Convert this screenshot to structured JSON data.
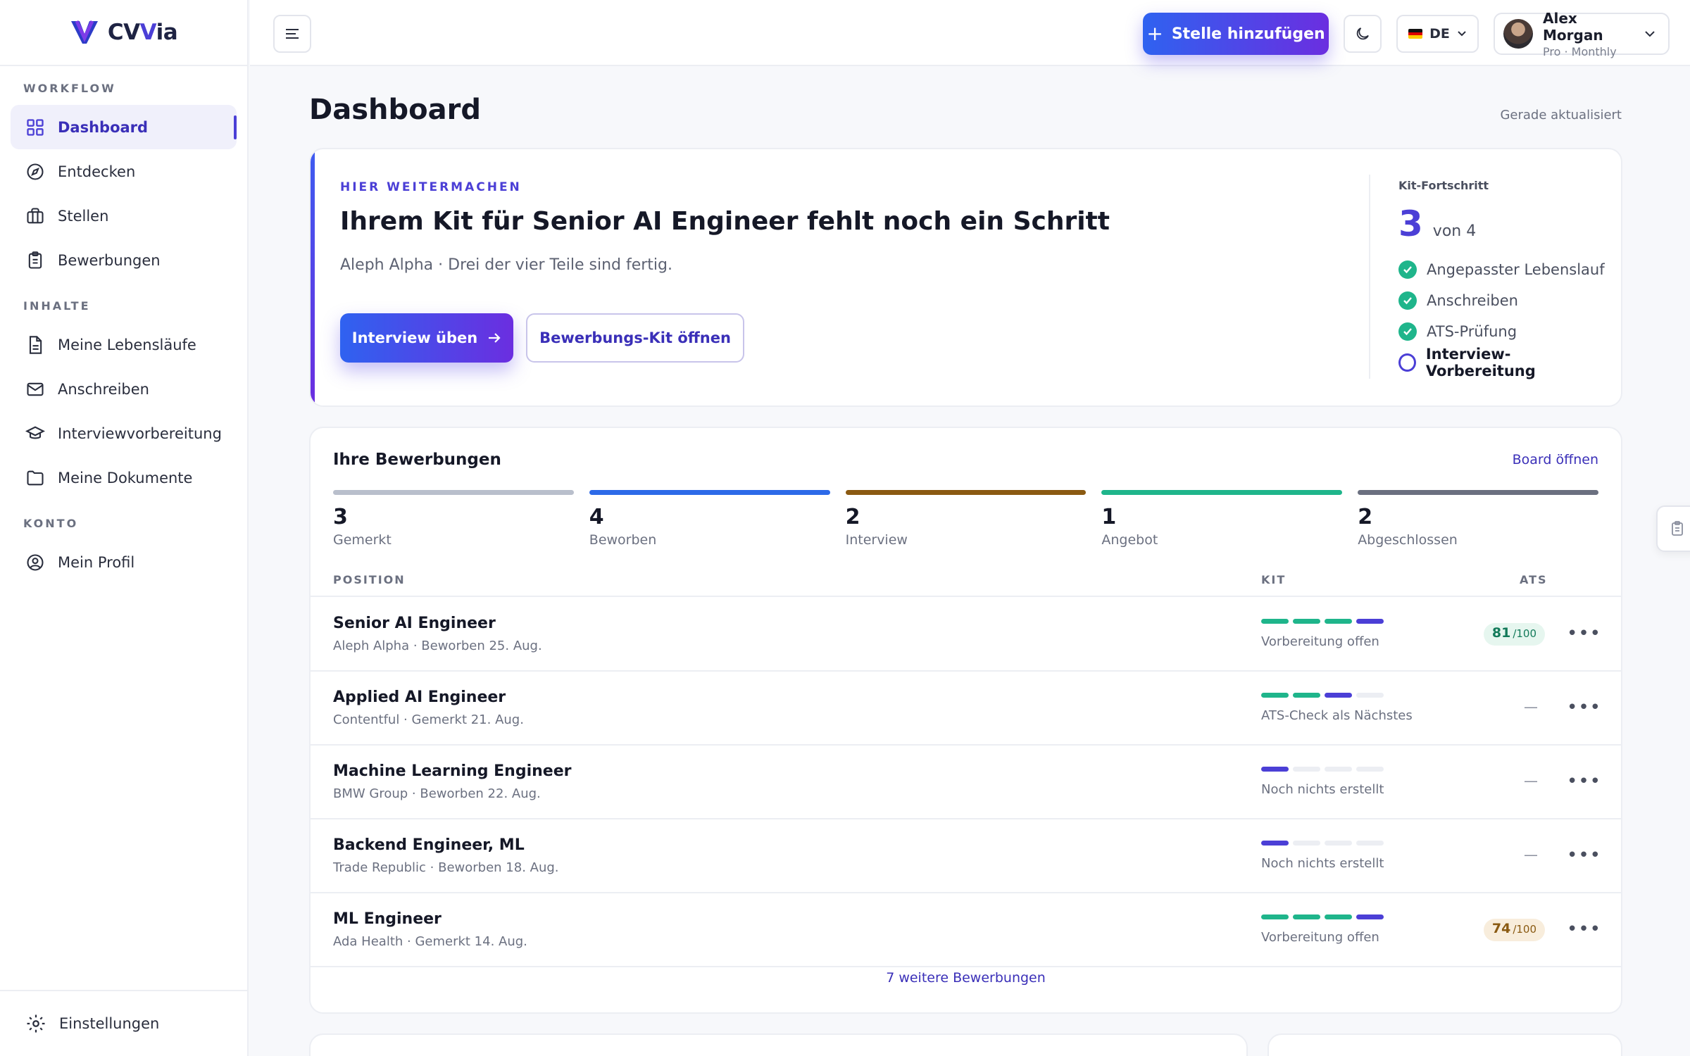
{
  "brand": {
    "name_prefix": "CV",
    "name_accent": "V",
    "name_suffix": "ia"
  },
  "sidebar": {
    "sections": [
      {
        "label": "WORKFLOW",
        "items": [
          {
            "label": "Dashboard",
            "icon": "grid-icon",
            "active": true
          },
          {
            "label": "Entdecken",
            "icon": "compass-icon"
          },
          {
            "label": "Stellen",
            "icon": "briefcase-icon"
          },
          {
            "label": "Bewerbungen",
            "icon": "clipboard-icon"
          }
        ]
      },
      {
        "label": "INHALTE",
        "items": [
          {
            "label": "Meine Lebensläufe",
            "icon": "document-icon"
          },
          {
            "label": "Anschreiben",
            "icon": "mail-icon"
          },
          {
            "label": "Interviewvorbereitung",
            "icon": "graduation-cap-icon"
          },
          {
            "label": "Meine Dokumente",
            "icon": "folder-icon"
          }
        ]
      },
      {
        "label": "KONTO",
        "items": [
          {
            "label": "Mein Profil",
            "icon": "user-circle-icon"
          }
        ]
      }
    ],
    "footer_label": "Einstellungen"
  },
  "topbar": {
    "add_job_label": "Stelle hinzufügen",
    "language": "DE",
    "user": {
      "name": "Alex Morgan",
      "plan": "Pro · Monthly"
    }
  },
  "page": {
    "title": "Dashboard",
    "updated": "Gerade aktualisiert"
  },
  "hero": {
    "eyebrow": "HIER WEITERMACHEN",
    "title": "Ihrem Kit für Senior AI Engineer fehlt noch ein Schritt",
    "subtitle": "Aleph Alpha · Drei der vier Teile sind fertig.",
    "primary_label": "Interview üben",
    "secondary_label": "Bewerbungs-Kit öffnen",
    "kit": {
      "label": "Kit-Fortschritt",
      "done": "3",
      "of": "von 4",
      "steps": [
        {
          "label": "Angepasster Lebenslauf",
          "done": true
        },
        {
          "label": "Anschreiben",
          "done": true
        },
        {
          "label": "ATS-Prüfung",
          "done": true
        },
        {
          "label": "Interview-Vorbereitung",
          "done": false
        }
      ]
    }
  },
  "applications": {
    "title": "Ihre Bewerbungen",
    "board_link": "Board öffnen",
    "stages": [
      {
        "count": "3",
        "label": "Gemerkt",
        "color": "#b9bfcc"
      },
      {
        "count": "4",
        "label": "Beworben",
        "color": "#2d6ae8"
      },
      {
        "count": "2",
        "label": "Interview",
        "color": "#8b5a12"
      },
      {
        "count": "1",
        "label": "Angebot",
        "color": "#1fb58b"
      },
      {
        "count": "2",
        "label": "Abgeschlossen",
        "color": "#6b7080"
      }
    ],
    "columns": {
      "position": "POSITION",
      "kit": "KIT",
      "ats": "ATS"
    },
    "rows": [
      {
        "title": "Senior AI Engineer",
        "subtitle": "Aleph Alpha · Beworben 25. Aug.",
        "kit_done": 3,
        "kit_current": true,
        "status": "Vorbereitung offen",
        "ats": "81",
        "ats_max": "/100",
        "ats_tone": "green"
      },
      {
        "title": "Applied AI Engineer",
        "subtitle": "Contentful · Gemerkt 21. Aug.",
        "kit_done": 2,
        "kit_current": true,
        "status": "ATS-Check als Nächstes",
        "ats": "—",
        "ats_max": "",
        "ats_tone": "none"
      },
      {
        "title": "Machine Learning Engineer",
        "subtitle": "BMW Group · Beworben 22. Aug.",
        "kit_done": 0,
        "kit_current": true,
        "status": "Noch nichts erstellt",
        "ats": "—",
        "ats_max": "",
        "ats_tone": "none"
      },
      {
        "title": "Backend Engineer, ML",
        "subtitle": "Trade Republic · Beworben 18. Aug.",
        "kit_done": 0,
        "kit_current": true,
        "status": "Noch nichts erstellt",
        "ats": "—",
        "ats_max": "",
        "ats_tone": "none"
      },
      {
        "title": "ML Engineer",
        "subtitle": "Ada Health · Gemerkt 14. Aug.",
        "kit_done": 3,
        "kit_current": true,
        "status": "Vorbereitung offen",
        "ats": "74",
        "ats_max": "/100",
        "ats_tone": "amber"
      }
    ],
    "more_link": "7 weitere Bewerbungen"
  },
  "colors": {
    "accent": "#4b3fd6",
    "success": "#1fb58b",
    "gradient_start": "#2f62f0",
    "gradient_end": "#6b2ee0"
  }
}
